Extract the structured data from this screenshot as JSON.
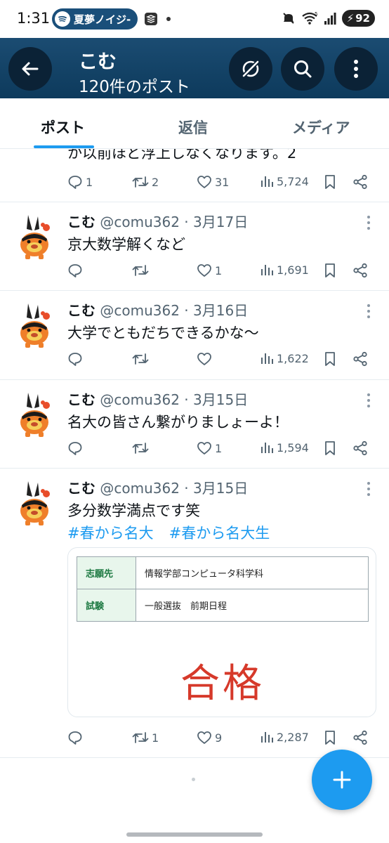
{
  "status_bar": {
    "time": "1:31",
    "media_title": "夏夢ノイジ-",
    "battery": "92",
    "signal_label": "5"
  },
  "header": {
    "title": "こむ",
    "subtitle": "120件のポスト"
  },
  "tabs": [
    {
      "label": "ポスト",
      "active": true
    },
    {
      "label": "返信",
      "active": false
    },
    {
      "label": "メディア",
      "active": false
    }
  ],
  "tweets": [
    {
      "partial": true,
      "text": "か以前ほど浮上しなくなります。2",
      "replies": "1",
      "retweets": "2",
      "likes": "31",
      "views": "5,724"
    },
    {
      "name": "こむ",
      "handle": "@comu362",
      "date": "3月17日",
      "text": "京大数学解くなど",
      "replies": "",
      "retweets": "",
      "likes": "1",
      "views": "1,691"
    },
    {
      "name": "こむ",
      "handle": "@comu362",
      "date": "3月16日",
      "text": "大学でともだちできるかな～",
      "replies": "",
      "retweets": "",
      "likes": "",
      "views": "1,622"
    },
    {
      "name": "こむ",
      "handle": "@comu362",
      "date": "3月15日",
      "text": "名大の皆さん繋がりましょーよ！",
      "replies": "",
      "retweets": "",
      "likes": "1",
      "views": "1,594"
    },
    {
      "name": "こむ",
      "handle": "@comu362",
      "date": "3月15日",
      "text": "多分数学満点です笑",
      "hashtags": [
        "#春から名大",
        "#春から名大生"
      ],
      "card": {
        "rows": [
          {
            "key": "志願先",
            "value": "情報学部コンピュータ科学科"
          },
          {
            "key": "試験",
            "value": "一般選抜　前期日程"
          }
        ],
        "result": "合格"
      },
      "replies": "",
      "retweets": "1",
      "likes": "9",
      "views": "2,287"
    }
  ],
  "colors": {
    "accent": "#1d9bf0",
    "header_bg": "#1b4c72",
    "text_secondary": "#536471",
    "pass_red": "#d6392a"
  }
}
